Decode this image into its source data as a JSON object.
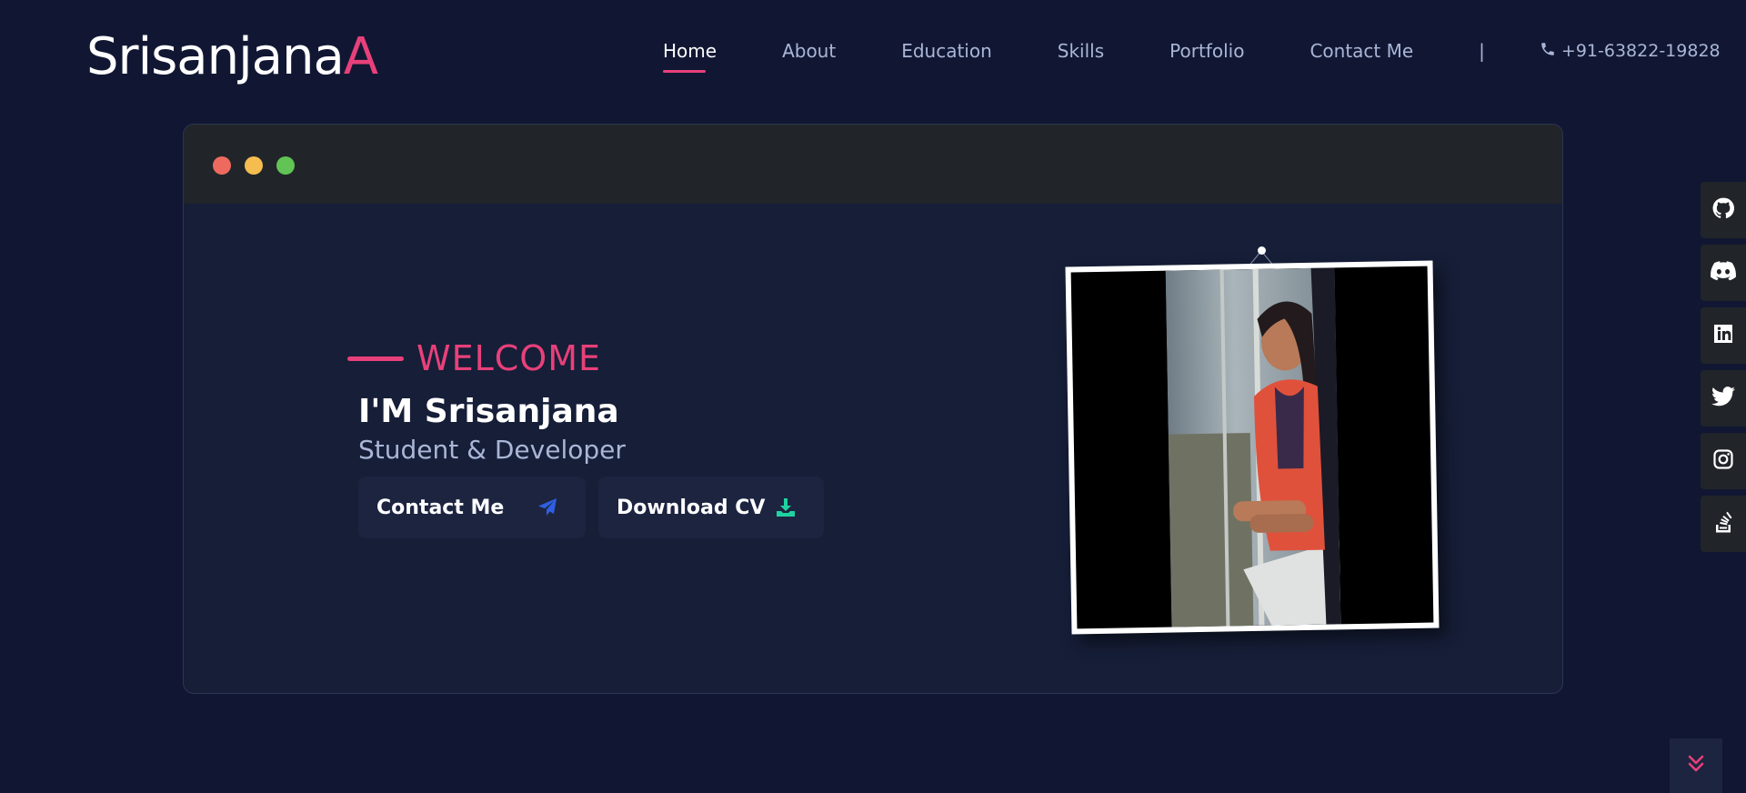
{
  "header": {
    "logo_main": "Srisanjana",
    "logo_accent": "A",
    "nav": [
      {
        "label": "Home",
        "active": true
      },
      {
        "label": "About"
      },
      {
        "label": "Education"
      },
      {
        "label": "Skills"
      },
      {
        "label": "Portfolio"
      },
      {
        "label": "Contact Me"
      }
    ],
    "separator": "|",
    "phone": "+91-63822-19828"
  },
  "window": {
    "controls": [
      "close",
      "minimize",
      "maximize"
    ]
  },
  "hero": {
    "welcome": "WELCOME",
    "name": "I'M Srisanjana",
    "role": "Student & Developer",
    "contact_button": "Contact Me",
    "cv_button": "Download CV"
  },
  "social": [
    "github-icon",
    "discord-icon",
    "linkedin-icon",
    "twitter-icon",
    "instagram-icon",
    "stackoverflow-icon"
  ],
  "colors": {
    "background": "#111733",
    "accent": "#e8407a",
    "window_bar": "#212529",
    "nav_text": "#a9b6d6",
    "send_icon": "#2f5fe0",
    "download_icon": "#1fd3a0"
  }
}
